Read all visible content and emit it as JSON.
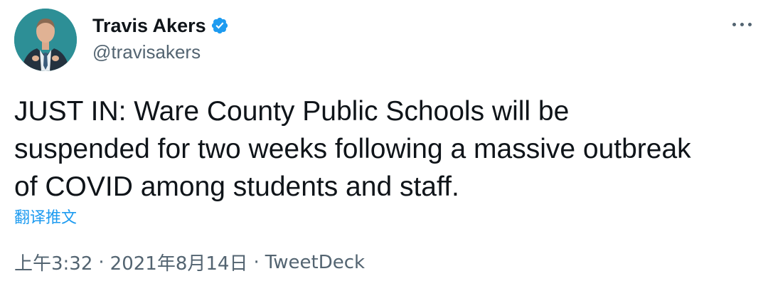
{
  "author": {
    "display_name": "Travis Akers",
    "handle": "@travisakers",
    "verified": true
  },
  "tweet": {
    "text": "JUST IN: Ware County Public Schools will be\nsuspended for two weeks following a massive outbreak\nof COVID among students and staff.",
    "translate_label": "翻译推文",
    "time": "上午3:32",
    "date": "2021年8月14日",
    "separator": "·",
    "source": "TweetDeck"
  },
  "icons": {
    "verified": "verified-badge-icon",
    "more": "more-options-icon"
  },
  "colors": {
    "link": "#1d9bf0",
    "secondary_text": "#536471",
    "primary_text": "#0f1419",
    "avatar_bg": "#2a8c93"
  }
}
